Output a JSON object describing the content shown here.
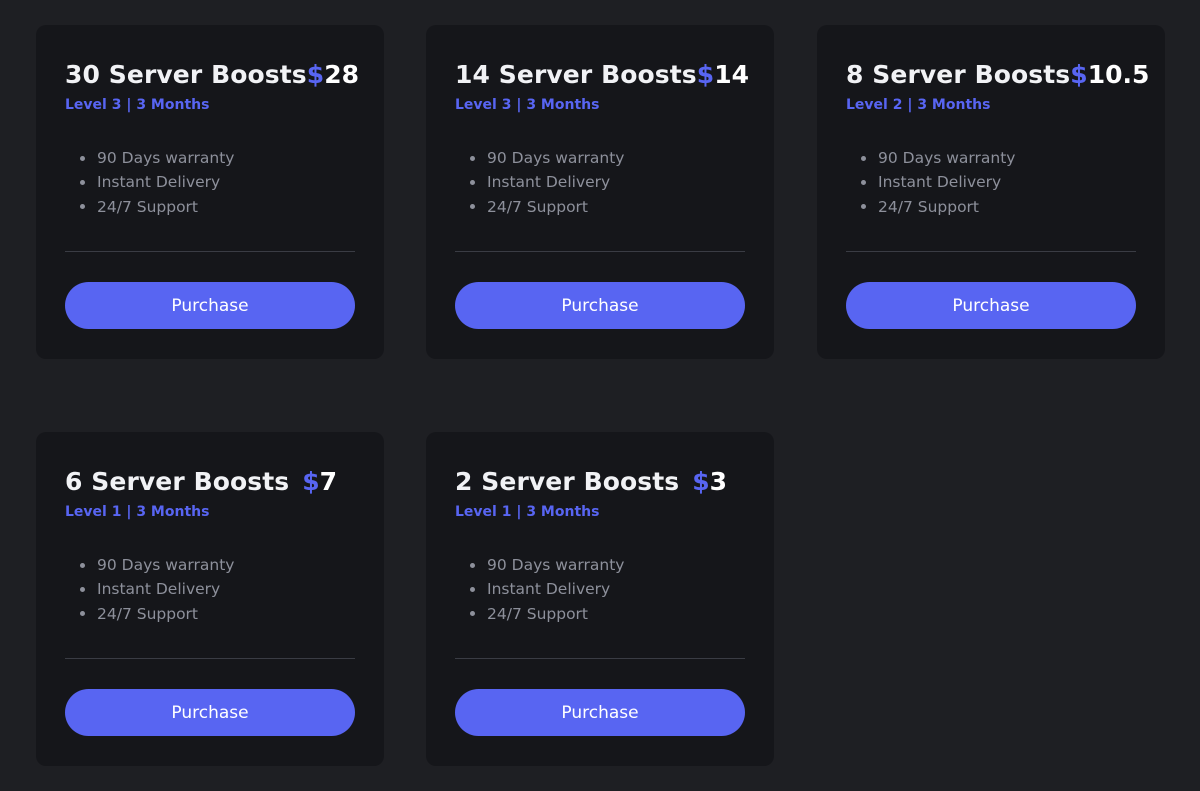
{
  "colors": {
    "background": "#1e1f23",
    "card": "#15161a",
    "accent": "#5865f2",
    "title": "#f1f2f5",
    "muted": "#8d909b",
    "divider": "#3a3c44"
  },
  "cards": [
    {
      "title": "30 Server Boosts",
      "currency": "$",
      "price": "28",
      "subtitle": "Level 3 | 3 Months",
      "features": [
        "90 Days warranty",
        "Instant Delivery",
        "24/7 Support"
      ],
      "button": "Purchase"
    },
    {
      "title": "14 Server Boosts",
      "currency": "$",
      "price": "14",
      "subtitle": "Level 3 | 3 Months",
      "features": [
        "90 Days warranty",
        "Instant Delivery",
        "24/7 Support"
      ],
      "button": "Purchase"
    },
    {
      "title": "8 Server Boosts",
      "currency": "$",
      "price": "10.5",
      "subtitle": "Level 2 | 3 Months",
      "features": [
        "90 Days warranty",
        "Instant Delivery",
        "24/7 Support"
      ],
      "button": "Purchase"
    },
    {
      "title": "6 Server Boosts",
      "currency": "$",
      "price": "7",
      "subtitle": "Level 1 | 3 Months",
      "features": [
        "90 Days warranty",
        "Instant Delivery",
        "24/7 Support"
      ],
      "button": "Purchase"
    },
    {
      "title": "2 Server Boosts",
      "currency": "$",
      "price": "3",
      "subtitle": "Level 1 | 3 Months",
      "features": [
        "90 Days warranty",
        "Instant Delivery",
        "24/7 Support"
      ],
      "button": "Purchase"
    }
  ]
}
